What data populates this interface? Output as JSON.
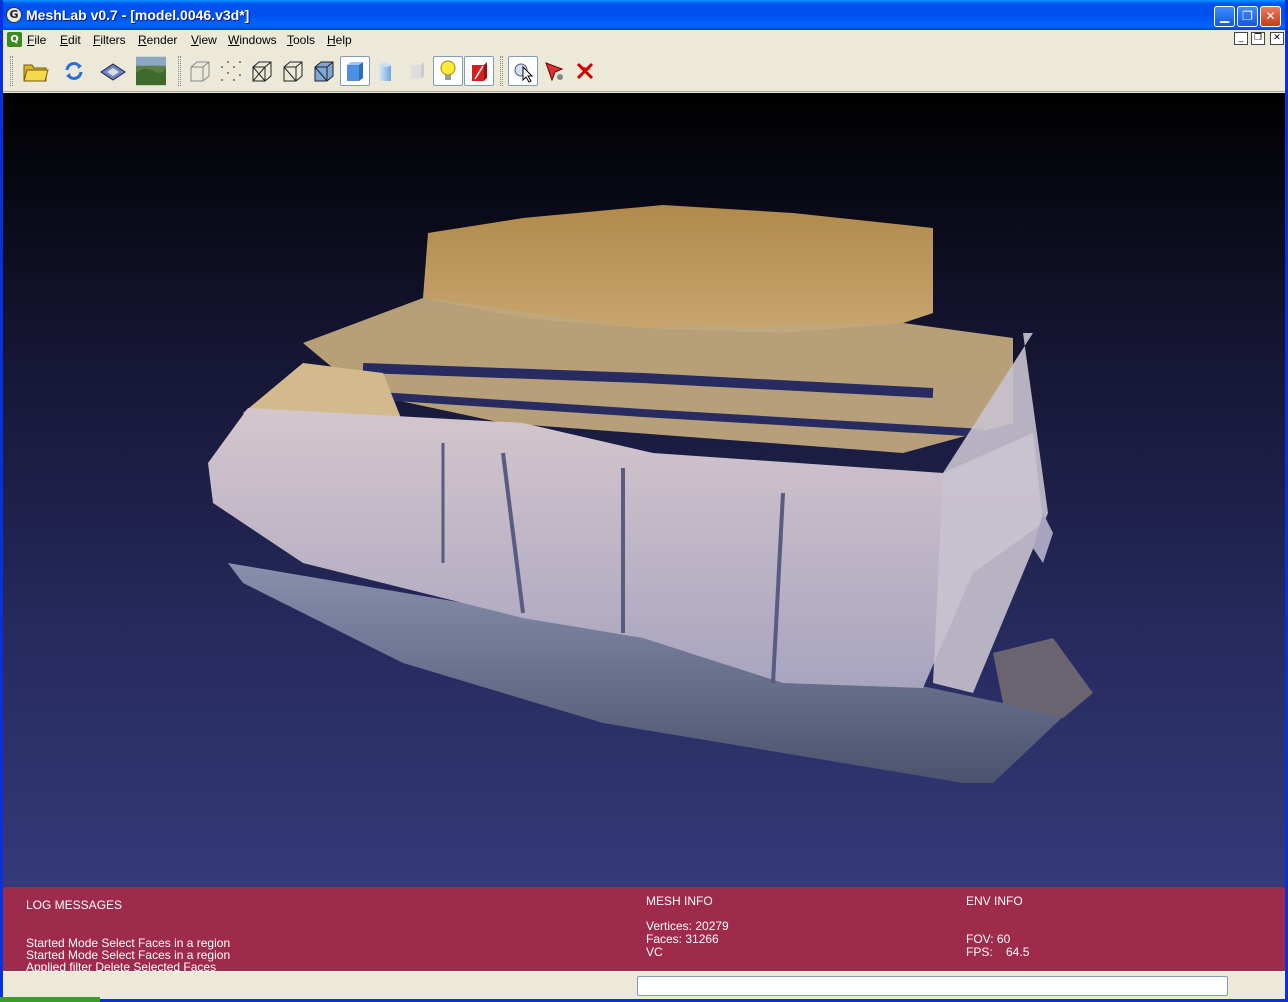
{
  "window": {
    "title": "MeshLab v0.7 - [model.0046.v3d*]",
    "app_icon_glyph": "G",
    "minimize_glyph": "▁",
    "maximize_glyph": "❐",
    "close_glyph": "✕"
  },
  "menubar": {
    "items": [
      {
        "label": "File",
        "key": "F",
        "rest": "ile"
      },
      {
        "label": "Edit",
        "key": "E",
        "rest": "dit"
      },
      {
        "label": "Filters",
        "key": "F",
        "rest": "ilters"
      },
      {
        "label": "Render",
        "key": "R",
        "rest": "ender"
      },
      {
        "label": "View",
        "key": "V",
        "rest": "iew"
      },
      {
        "label": "Windows",
        "key": "W",
        "rest": "indows"
      },
      {
        "label": "Tools",
        "key": "T",
        "rest": "ools"
      },
      {
        "label": "Help",
        "key": "H",
        "rest": "elp"
      }
    ],
    "mdi_icon_glyph": "Q",
    "mdi_min": "_",
    "mdi_restore": "❐",
    "mdi_close": "✕"
  },
  "toolbar": {
    "tools": [
      {
        "name": "open-folder-icon",
        "active": false
      },
      {
        "name": "reload-icon",
        "active": false
      },
      {
        "name": "save-disk-icon",
        "active": false
      },
      {
        "name": "snapshot-icon",
        "active": false
      },
      {
        "name": "bounding-box-icon",
        "active": false
      },
      {
        "name": "points-icon",
        "active": false
      },
      {
        "name": "wireframe-icon",
        "active": false
      },
      {
        "name": "hidden-lines-icon",
        "active": false
      },
      {
        "name": "flat-lines-icon",
        "active": false
      },
      {
        "name": "flat-shading-icon",
        "active": true
      },
      {
        "name": "smooth-shading-icon",
        "active": false
      },
      {
        "name": "texture-icon",
        "active": false
      },
      {
        "name": "light-bulb-icon",
        "active": true
      },
      {
        "name": "double-side-lighting-icon",
        "active": true
      },
      {
        "name": "select-faces-icon",
        "active": true
      },
      {
        "name": "select-vertex-icon",
        "active": false
      },
      {
        "name": "delete-selected-icon",
        "active": false
      }
    ]
  },
  "info": {
    "log_header": "LOG MESSAGES",
    "log_lines": [
      "Started Mode Select Faces in a region",
      "Started Mode Select Faces in a region",
      "Applied filter Delete Selected Faces"
    ],
    "mesh_header": "MESH INFO",
    "vertices": "Vertices: 20279",
    "faces": "Faces: 31266",
    "vc": "VC",
    "env_header": "ENV INFO",
    "fov": "FOV: 60",
    "fps": "FPS:    64.5"
  },
  "colors": {
    "info_panel": "#9e2b4b",
    "title_bar": "#0053ee",
    "viewport_top": "#000000",
    "viewport_bottom": "#353a78"
  }
}
